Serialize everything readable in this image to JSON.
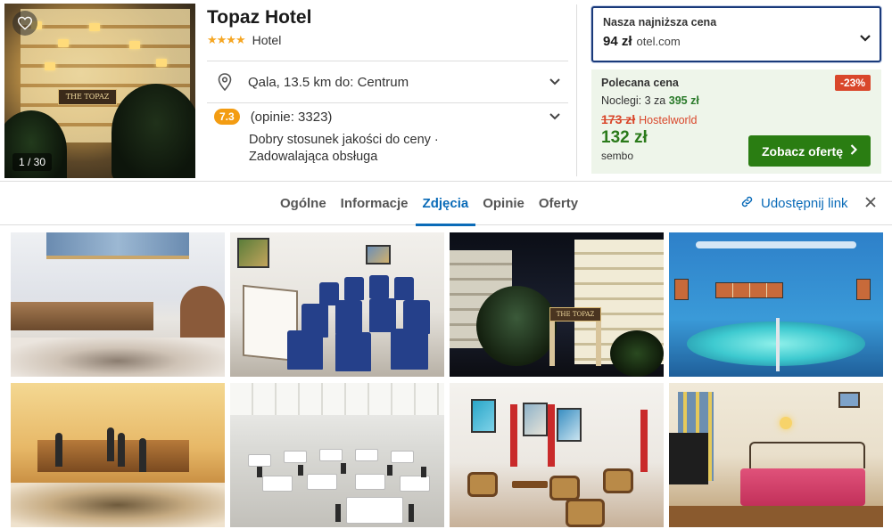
{
  "hotel": {
    "name": "Topaz Hotel",
    "stars": "★★★★",
    "type": "Hotel",
    "photo_counter": "1 / 30",
    "hero_sign": "THE TOPAZ"
  },
  "location": {
    "text": "Qala, 13.5 km do: Centrum"
  },
  "rating": {
    "score": "7.3",
    "count": "(opinie: 3323)",
    "description": "Dobry stosunek jakości do ceny · Zadowalająca obsługa"
  },
  "best_price": {
    "label": "Nasza najniższa cena",
    "price": "94 zł",
    "provider": "otel.com"
  },
  "recommended": {
    "label": "Polecana cena",
    "discount": "-23%",
    "nights_prefix": "Noclegi: 3 za",
    "nights_total": "395 zł",
    "old_price": "173 zł",
    "old_provider": "Hostelworld",
    "price": "132 zł",
    "provider": "sembo",
    "cta": "Zobacz ofertę"
  },
  "tabs": [
    {
      "label": "Ogólne"
    },
    {
      "label": "Informacje"
    },
    {
      "label": "Zdjęcia"
    },
    {
      "label": "Opinie"
    },
    {
      "label": "Oferty"
    }
  ],
  "active_tab": "Zdjęcia",
  "share": {
    "label": "Udostępnij link"
  },
  "gallery": {
    "exterior_sign": "THE TOPAZ"
  },
  "colors": {
    "accent": "#0a6bb8",
    "cta": "#2a7d12",
    "discount": "#d9472b",
    "rating": "#f39c12",
    "star": "#f5a623"
  },
  "icons": {
    "favorite": "heart-icon",
    "location": "map-pin-icon",
    "expand": "chevron-down-icon",
    "share": "link-icon",
    "close": "close-icon",
    "cta_arrow": "chevron-right-icon"
  }
}
